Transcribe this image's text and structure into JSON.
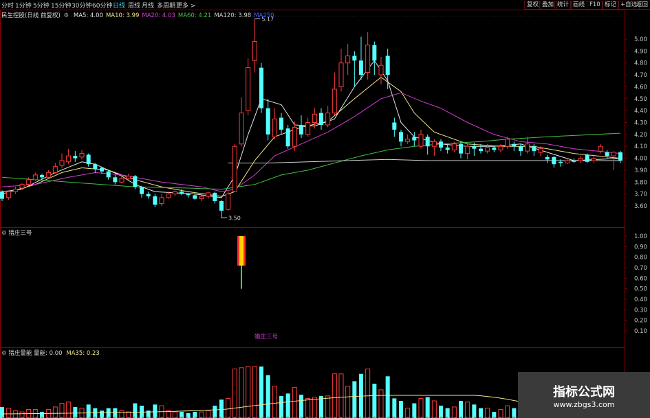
{
  "toolbar": {
    "tabs": [
      "分时",
      "1分钟",
      "5分钟",
      "15分钟",
      "30分钟",
      "60分钟",
      "日线",
      "周线",
      "月线",
      "多周期",
      "更多 >"
    ],
    "active_tab": "日线",
    "right_buttons": [
      "复权",
      "叠加",
      "统计",
      "画线",
      "F10",
      "标记",
      "+自选",
      "返回"
    ]
  },
  "main_panel": {
    "stock_title": "民生控股(日线 前复权)",
    "indicators": [
      {
        "name": "MA5",
        "value": "4.00",
        "color": "#e8e8e8"
      },
      {
        "name": "MA10",
        "value": "3.99",
        "color": "#f0e68c"
      },
      {
        "name": "MA20",
        "value": "4.03",
        "color": "#d33cd3"
      },
      {
        "name": "MA60",
        "value": "4.21",
        "color": "#3fbf3f"
      },
      {
        "name": "MA120",
        "value": "3.98",
        "color": "#cfcfcf"
      },
      {
        "name": "MA250",
        "value": "",
        "color": "#3a5fff"
      }
    ],
    "high_label": "5.17",
    "low_label": "3.50",
    "y_ticks": [
      "5.00",
      "4.90",
      "4.80",
      "4.70",
      "4.60",
      "4.50",
      "4.40",
      "4.30",
      "4.20",
      "4.10",
      "4.00",
      "3.90",
      "3.80",
      "3.70",
      "3.60"
    ]
  },
  "signal_panel": {
    "title": "猎庄三号",
    "signal_label": "猎庄三号",
    "y_ticks": [
      "1.00",
      "0.90",
      "0.80",
      "0.70",
      "0.60",
      "0.50",
      "0.40",
      "0.30",
      "0.20",
      "0.10"
    ]
  },
  "volume_panel": {
    "title": "猎庄量能",
    "series_label": "量能",
    "series_value": "0.00",
    "ma_label": "MA35",
    "ma_value": "0.23"
  },
  "watermark": {
    "title": "指标公式网",
    "subtitle": "www.zbgs3.com"
  },
  "colors": {
    "up": "#ff3b3b",
    "down": "#54ffff",
    "frame": "#8b0000",
    "axis_text": "#c8c8c8"
  },
  "chart_data": {
    "type": "candlestick",
    "price_ylim": [
      3.5,
      5.17
    ],
    "candles": [
      [
        3.72,
        3.66,
        3.73,
        3.64
      ],
      [
        3.67,
        3.72,
        3.73,
        3.65
      ],
      [
        3.72,
        3.74,
        3.76,
        3.7
      ],
      [
        3.75,
        3.78,
        3.79,
        3.74
      ],
      [
        3.78,
        3.82,
        3.84,
        3.77
      ],
      [
        3.82,
        3.86,
        3.88,
        3.81
      ],
      [
        3.86,
        3.84,
        3.87,
        3.82
      ],
      [
        3.84,
        3.88,
        3.9,
        3.83
      ],
      [
        3.88,
        3.93,
        3.96,
        3.87
      ],
      [
        3.94,
        3.98,
        4.04,
        3.92
      ],
      [
        3.97,
        4.02,
        4.08,
        3.95
      ],
      [
        4.02,
        4.0,
        4.06,
        3.97
      ],
      [
        4.01,
        4.04,
        4.07,
        3.99
      ],
      [
        4.03,
        3.95,
        4.04,
        3.93
      ],
      [
        3.95,
        3.91,
        3.96,
        3.88
      ],
      [
        3.92,
        3.89,
        3.93,
        3.87
      ],
      [
        3.89,
        3.84,
        3.9,
        3.82
      ],
      [
        3.84,
        3.8,
        3.86,
        3.78
      ],
      [
        3.8,
        3.83,
        3.85,
        3.79
      ],
      [
        3.83,
        3.85,
        3.87,
        3.82
      ],
      [
        3.85,
        3.76,
        3.86,
        3.74
      ],
      [
        3.76,
        3.7,
        3.77,
        3.67
      ],
      [
        3.7,
        3.68,
        3.72,
        3.66
      ],
      [
        3.68,
        3.61,
        3.7,
        3.59
      ],
      [
        3.62,
        3.67,
        3.7,
        3.6
      ],
      [
        3.67,
        3.7,
        3.72,
        3.66
      ],
      [
        3.7,
        3.72,
        3.73,
        3.68
      ],
      [
        3.72,
        3.7,
        3.74,
        3.69
      ],
      [
        3.7,
        3.69,
        3.71,
        3.67
      ],
      [
        3.69,
        3.66,
        3.7,
        3.65
      ],
      [
        3.66,
        3.68,
        3.69,
        3.64
      ],
      [
        3.68,
        3.71,
        3.72,
        3.66
      ],
      [
        3.71,
        3.64,
        3.72,
        3.62
      ],
      [
        3.64,
        3.56,
        3.65,
        3.5
      ],
      [
        3.57,
        3.7,
        3.72,
        3.56
      ],
      [
        3.72,
        4.1,
        4.12,
        3.72
      ],
      [
        4.12,
        4.38,
        4.51,
        4.1
      ],
      [
        4.4,
        4.76,
        4.84,
        4.36
      ],
      [
        4.82,
        4.98,
        5.17,
        4.72
      ],
      [
        4.76,
        4.42,
        4.8,
        4.38
      ],
      [
        4.42,
        4.2,
        4.5,
        4.15
      ],
      [
        4.18,
        4.33,
        4.42,
        4.16
      ],
      [
        4.34,
        4.24,
        4.38,
        4.2
      ],
      [
        4.25,
        4.1,
        4.28,
        4.08
      ],
      [
        4.1,
        4.26,
        4.31,
        4.06
      ],
      [
        4.28,
        4.2,
        4.36,
        4.17
      ],
      [
        4.2,
        4.3,
        4.34,
        4.18
      ],
      [
        4.3,
        4.37,
        4.42,
        4.25
      ],
      [
        4.38,
        4.28,
        4.42,
        4.24
      ],
      [
        4.28,
        4.38,
        4.44,
        4.26
      ],
      [
        4.38,
        4.58,
        4.72,
        4.36
      ],
      [
        4.6,
        4.8,
        4.92,
        4.56
      ],
      [
        4.8,
        4.86,
        4.96,
        4.7
      ],
      [
        4.86,
        4.82,
        4.9,
        4.6
      ],
      [
        4.82,
        4.7,
        5.02,
        4.66
      ],
      [
        4.72,
        4.95,
        5.06,
        4.66
      ],
      [
        4.95,
        4.82,
        4.98,
        4.7
      ],
      [
        4.7,
        4.78,
        4.85,
        4.62
      ],
      [
        4.86,
        4.7,
        4.92,
        4.58
      ],
      [
        4.3,
        4.24,
        4.34,
        4.18
      ],
      [
        4.22,
        4.14,
        4.24,
        4.1
      ],
      [
        4.14,
        4.16,
        4.2,
        4.12
      ],
      [
        4.18,
        4.15,
        4.22,
        4.1
      ],
      [
        4.1,
        4.2,
        4.24,
        4.08
      ],
      [
        4.18,
        4.1,
        4.2,
        4.03
      ],
      [
        4.1,
        4.14,
        4.16,
        4.02
      ],
      [
        4.14,
        4.09,
        4.16,
        4.06
      ],
      [
        4.09,
        4.07,
        4.12,
        4.04
      ],
      [
        4.07,
        4.12,
        4.14,
        4.05
      ],
      [
        4.12,
        4.04,
        4.14,
        4.0
      ],
      [
        4.04,
        4.1,
        4.12,
        3.99
      ],
      [
        4.1,
        4.08,
        4.13,
        4.02
      ],
      [
        4.08,
        4.06,
        4.12,
        4.04
      ],
      [
        4.06,
        4.09,
        4.12,
        4.04
      ],
      [
        4.09,
        4.07,
        4.1,
        4.05
      ],
      [
        4.07,
        4.1,
        4.12,
        4.05
      ],
      [
        4.1,
        4.16,
        4.18,
        4.08
      ],
      [
        4.12,
        4.1,
        4.14,
        4.06
      ],
      [
        4.1,
        4.06,
        4.12,
        4.02
      ],
      [
        4.06,
        4.12,
        4.18,
        4.04
      ],
      [
        4.1,
        4.06,
        4.12,
        4.02
      ],
      [
        4.05,
        4.08,
        4.1,
        4.02
      ],
      [
        4.01,
        3.99,
        4.03,
        3.96
      ],
      [
        4.01,
        3.95,
        4.02,
        3.92
      ],
      [
        3.97,
        3.96,
        3.99,
        3.93
      ],
      [
        3.96,
        3.98,
        4.0,
        3.95
      ],
      [
        3.98,
        3.97,
        4.0,
        3.96
      ],
      [
        3.98,
        4.0,
        4.02,
        3.96
      ],
      [
        4.03,
        3.97,
        4.04,
        3.96
      ],
      [
        3.98,
        4.0,
        4.02,
        3.96
      ],
      [
        4.06,
        4.1,
        4.12,
        4.04
      ],
      [
        4.05,
        4.02,
        4.07,
        4.0
      ],
      [
        4.02,
        4.05,
        4.06,
        3.9
      ],
      [
        4.05,
        3.98,
        4.06,
        3.96
      ]
    ],
    "ma_lines": {
      "MA5": [
        [
          3.72,
          0
        ],
        [
          3.74,
          3
        ],
        [
          3.88,
          8
        ],
        [
          3.97,
          12
        ],
        [
          3.95,
          14
        ],
        [
          3.85,
          18
        ],
        [
          3.78,
          20
        ],
        [
          3.72,
          23
        ],
        [
          3.7,
          29
        ],
        [
          3.67,
          33
        ],
        [
          3.85,
          35
        ],
        [
          4.2,
          37
        ],
        [
          4.5,
          39
        ],
        [
          4.45,
          42
        ],
        [
          4.28,
          44
        ],
        [
          4.27,
          47
        ],
        [
          4.33,
          50
        ],
        [
          4.6,
          53
        ],
        [
          4.82,
          56
        ],
        [
          4.65,
          58
        ],
        [
          4.3,
          60
        ],
        [
          4.18,
          62
        ],
        [
          4.12,
          66
        ],
        [
          4.1,
          70
        ],
        [
          4.1,
          74
        ],
        [
          4.12,
          78
        ],
        [
          4.05,
          82
        ],
        [
          3.98,
          86
        ],
        [
          4.0,
          93
        ]
      ],
      "MA10": [
        [
          3.7,
          0
        ],
        [
          3.78,
          5
        ],
        [
          3.88,
          9
        ],
        [
          3.92,
          12
        ],
        [
          3.9,
          16
        ],
        [
          3.82,
          20
        ],
        [
          3.76,
          24
        ],
        [
          3.72,
          28
        ],
        [
          3.68,
          33
        ],
        [
          3.72,
          35
        ],
        [
          3.98,
          38
        ],
        [
          4.18,
          41
        ],
        [
          4.26,
          45
        ],
        [
          4.31,
          49
        ],
        [
          4.5,
          53
        ],
        [
          4.68,
          57
        ],
        [
          4.56,
          60
        ],
        [
          4.38,
          62
        ],
        [
          4.22,
          65
        ],
        [
          4.12,
          70
        ],
        [
          4.1,
          75
        ],
        [
          4.1,
          80
        ],
        [
          4.04,
          86
        ],
        [
          4.0,
          93
        ]
      ],
      "MA20": [
        [
          3.76,
          0
        ],
        [
          3.78,
          5
        ],
        [
          3.84,
          10
        ],
        [
          3.88,
          14
        ],
        [
          3.86,
          18
        ],
        [
          3.8,
          24
        ],
        [
          3.76,
          30
        ],
        [
          3.72,
          33
        ],
        [
          3.74,
          35
        ],
        [
          3.86,
          38
        ],
        [
          4.02,
          41
        ],
        [
          4.12,
          45
        ],
        [
          4.22,
          49
        ],
        [
          4.35,
          53
        ],
        [
          4.5,
          57
        ],
        [
          4.55,
          60
        ],
        [
          4.48,
          63
        ],
        [
          4.42,
          66
        ],
        [
          4.3,
          70
        ],
        [
          4.2,
          74
        ],
        [
          4.14,
          78
        ],
        [
          4.12,
          82
        ],
        [
          4.08,
          86
        ],
        [
          4.04,
          93
        ]
      ],
      "MA60": [
        [
          3.84,
          0
        ],
        [
          3.8,
          10
        ],
        [
          3.76,
          20
        ],
        [
          3.75,
          28
        ],
        [
          3.74,
          33
        ],
        [
          3.78,
          38
        ],
        [
          3.86,
          42
        ],
        [
          3.9,
          46
        ],
        [
          3.96,
          50
        ],
        [
          4.02,
          54
        ],
        [
          4.07,
          58
        ],
        [
          4.1,
          62
        ],
        [
          4.12,
          66
        ],
        [
          4.14,
          72
        ],
        [
          4.16,
          76
        ],
        [
          4.18,
          82
        ],
        [
          4.21,
          93
        ]
      ],
      "MA120": [
        [
          3.96,
          34
        ],
        [
          3.96,
          40
        ],
        [
          3.97,
          46
        ],
        [
          3.98,
          52
        ],
        [
          3.99,
          58
        ],
        [
          3.98,
          64
        ],
        [
          3.98,
          72
        ],
        [
          3.98,
          80
        ],
        [
          3.98,
          86
        ],
        [
          3.98,
          93
        ]
      ]
    },
    "signal": {
      "value": 1.0,
      "index": 36
    },
    "volume_ma35": 0.23
  }
}
